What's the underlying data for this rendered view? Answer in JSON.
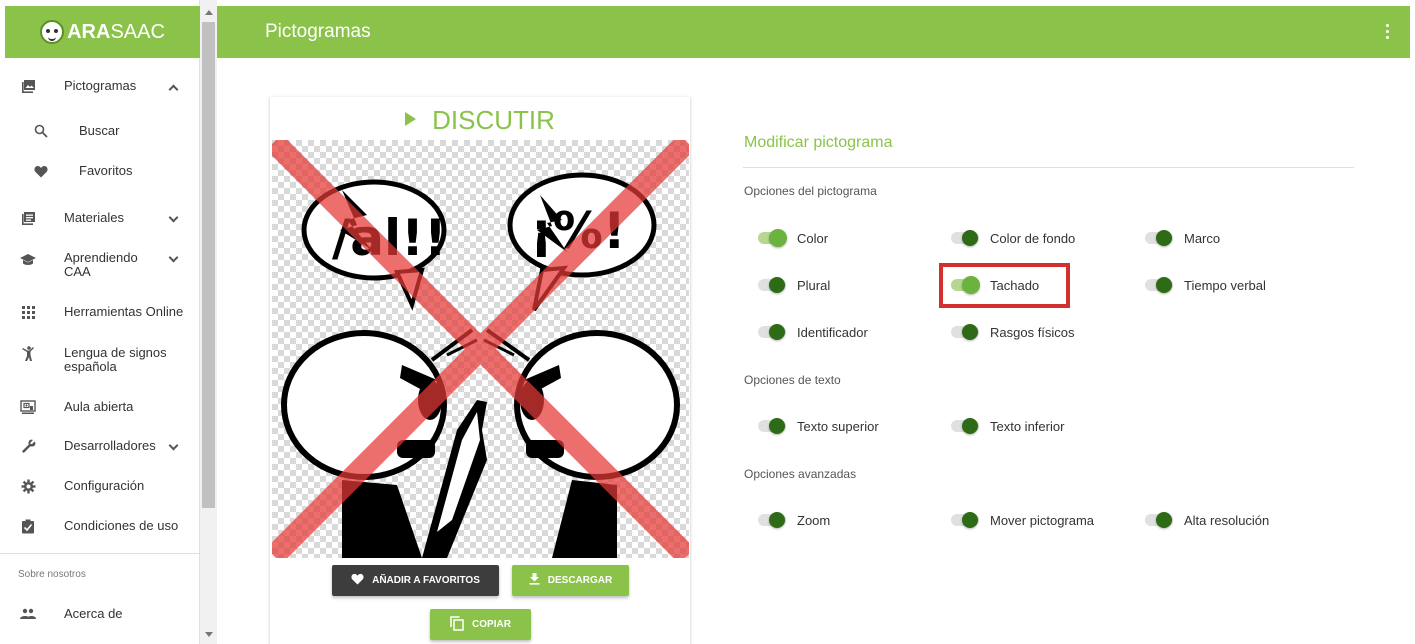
{
  "app": {
    "logo_text_bold": "ARA",
    "logo_text_regular": "SAAC"
  },
  "topbar": {
    "title": "Pictogramas"
  },
  "sidebar": {
    "items": [
      {
        "label": "Pictogramas",
        "icon": "image-stack-icon",
        "chevron": "up"
      },
      {
        "label": "Buscar",
        "icon": "search-icon"
      },
      {
        "label": "Favoritos",
        "icon": "heart-icon"
      },
      {
        "label": "Materiales",
        "icon": "document-icon",
        "chevron": "down"
      },
      {
        "label": "Aprendiendo CAA",
        "icon": "graduation-cap-icon",
        "chevron": "down"
      },
      {
        "label": "Herramientas Online",
        "icon": "grid-icon"
      },
      {
        "label": "Lengua de signos española",
        "icon": "person-sign-icon"
      },
      {
        "label": "Aula abierta",
        "icon": "presentation-icon"
      },
      {
        "label": "Desarrolladores",
        "icon": "wrench-icon",
        "chevron": "down"
      },
      {
        "label": "Configuración",
        "icon": "gear-icon"
      },
      {
        "label": "Condiciones de uso",
        "icon": "checklist-icon"
      }
    ],
    "section_title": "Sobre nosotros",
    "about_label": "Acerca de"
  },
  "card": {
    "word": "DISCUTIR",
    "fav_button": "AÑADIR A FAVORITOS",
    "download_button": "DESCARGAR",
    "copy_button": "COPIAR"
  },
  "options": {
    "title": "Modificar pictograma",
    "pictogram_section": "Opciones del pictograma",
    "pictogram_options": [
      {
        "label": "Color",
        "on": true
      },
      {
        "label": "Color de fondo",
        "on": false
      },
      {
        "label": "Marco",
        "on": false
      },
      {
        "label": "Plural",
        "on": false
      },
      {
        "label": "Tachado",
        "on": true
      },
      {
        "label": "Tiempo verbal",
        "on": false
      },
      {
        "label": "Identificador",
        "on": false
      },
      {
        "label": "Rasgos físicos",
        "on": false
      }
    ],
    "text_section": "Opciones de texto",
    "text_options": [
      {
        "label": "Texto superior",
        "on": false
      },
      {
        "label": "Texto inferior",
        "on": false
      }
    ],
    "advanced_section": "Opciones avanzadas",
    "advanced_options": [
      {
        "label": "Zoom",
        "on": false
      },
      {
        "label": "Mover pictograma",
        "on": false
      },
      {
        "label": "Alta resolución",
        "on": false
      }
    ]
  },
  "colors": {
    "brand_green": "#8bc34a",
    "toggle_on": "#6ab33e",
    "toggle_off": "#2e6b17",
    "highlight": "#d32f2f",
    "strike": "#e53935"
  }
}
